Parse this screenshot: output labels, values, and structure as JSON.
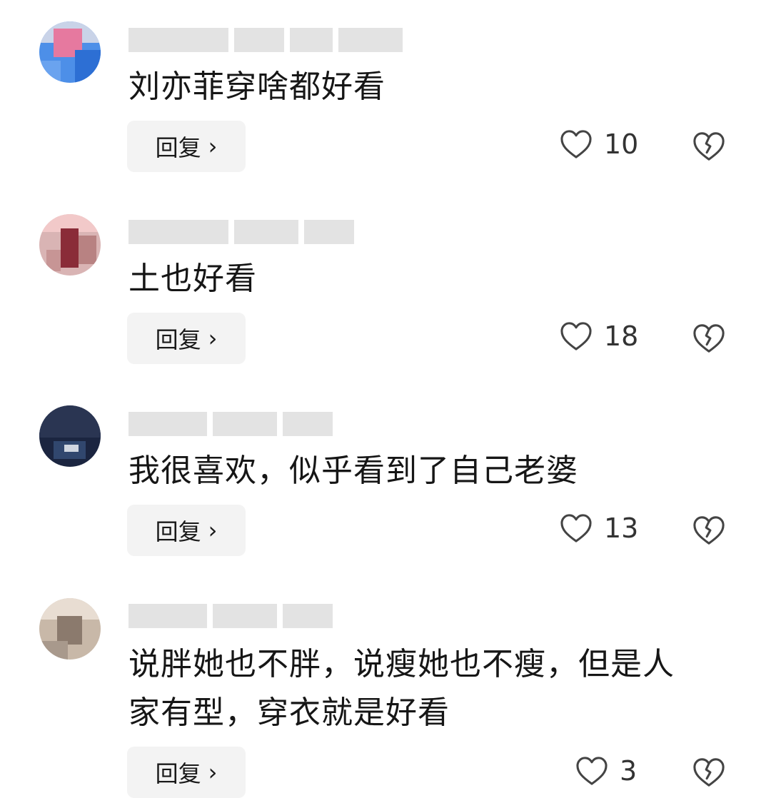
{
  "comments": [
    {
      "text": "刘亦菲穿啥都好看",
      "reply_label": "回复",
      "likes": "10",
      "avatar_colors": [
        "#4d8fe8",
        "#2d6fd4",
        "#e6799f"
      ]
    },
    {
      "text": "土也好看",
      "reply_label": "回复",
      "likes": "18",
      "avatar_colors": [
        "#d9b4b4",
        "#8a2c38",
        "#f2c9c9"
      ]
    },
    {
      "text": "我很喜欢，似乎看到了自己老婆",
      "reply_label": "回复",
      "likes": "13",
      "avatar_colors": [
        "#1b2540",
        "#31476e",
        "#d0d6e0"
      ]
    },
    {
      "text": "说胖她也不胖，说瘦她也不瘦，但是人\n家有型，穿衣就是好看",
      "reply_label": "回复",
      "likes": "3",
      "avatar_colors": [
        "#c8b8a8",
        "#8b7a6d",
        "#e8ddd2"
      ]
    }
  ],
  "icons": {
    "like": "heart-outline-icon",
    "dislike": "broken-heart-icon",
    "reply_chevron": "chevron-right-icon"
  },
  "colors": {
    "reply_bg": "#f3f3f3",
    "icon_stroke": "#444444",
    "text": "#161616"
  }
}
